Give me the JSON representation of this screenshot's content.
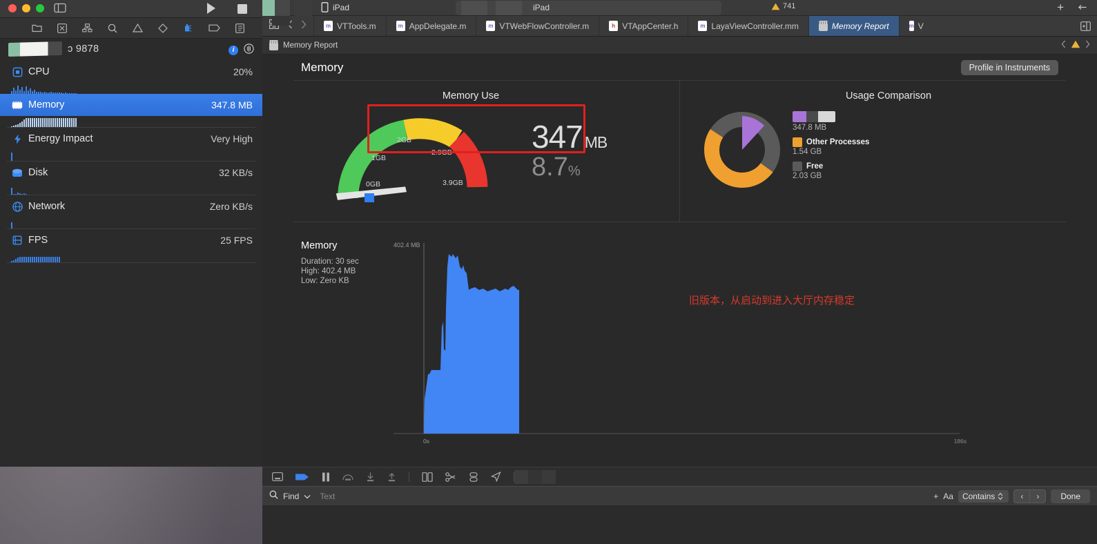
{
  "window": {
    "scheme_device": "iPad",
    "scheme_destination": "iPad",
    "warning_count": "741",
    "redacted_pid": "ɔ 9878"
  },
  "tabs": [
    {
      "label": "VTTools.m",
      "type": "m",
      "active": false
    },
    {
      "label": "AppDelegate.m",
      "type": "m",
      "active": false
    },
    {
      "label": "VTWebFlowController.m",
      "type": "m",
      "active": false
    },
    {
      "label": "VTAppCenter.h",
      "type": "h",
      "active": false
    },
    {
      "label": "LayaViewController.mm",
      "type": "m",
      "active": false
    },
    {
      "label": "Memory Report",
      "type": "mem",
      "active": true
    },
    {
      "label": "V",
      "type": "m",
      "active": false
    }
  ],
  "jumpbar": {
    "label": "Memory Report"
  },
  "gauges": {
    "items": [
      {
        "name": "CPU",
        "value": "20%",
        "selected": false
      },
      {
        "name": "Memory",
        "value": "347.8 MB",
        "selected": true
      },
      {
        "name": "Energy Impact",
        "value": "Very High",
        "selected": false
      },
      {
        "name": "Disk",
        "value": "32 KB/s",
        "selected": false
      },
      {
        "name": "Network",
        "value": "Zero KB/s",
        "selected": false
      },
      {
        "name": "FPS",
        "value": "25 FPS",
        "selected": false
      }
    ]
  },
  "report": {
    "title": "Memory",
    "profile_button": "Profile in Instruments"
  },
  "chart_data": [
    {
      "type": "gauge",
      "title": "Memory Use",
      "value": 347,
      "unit": "MB",
      "percent": "8.7",
      "percent_unit": "%",
      "value_display": "347",
      "tick_labels": [
        "0GB",
        "1GB",
        "2GB",
        "2.9GB",
        "3.9GB"
      ],
      "zones": [
        {
          "color": "#4ec95a",
          "from": "0GB",
          "to": "2GB"
        },
        {
          "color": "#f5cc2a",
          "from": "2GB",
          "to": "2.9GB"
        },
        {
          "color": "#e8352e",
          "from": "2.9GB",
          "to": "3.9GB"
        }
      ],
      "needle_value_marker_color": "#2f7ff0",
      "highlight_box_color": "#e02020"
    },
    {
      "type": "pie",
      "title": "Usage Comparison",
      "categories": [
        "App (redacted)",
        "Other Processes",
        "Free"
      ],
      "values": [
        0.3478,
        1.54,
        2.03
      ],
      "value_labels": [
        "347.8 MB",
        "1.54 GB",
        "2.03 GB"
      ],
      "colors": [
        "#a974d8",
        "#f0a030",
        "#5a5a5a"
      ],
      "legend": "right",
      "app_label_redacted": true
    },
    {
      "type": "area",
      "title": "Memory",
      "duration": "Duration: 30 sec",
      "high": "High: 402.4 MB",
      "low": "Low: Zero KB",
      "ylabel": "402.4 MB",
      "ylim": [
        0,
        402.4
      ],
      "xlabel_start": "0s",
      "xlabel_end": "186s",
      "series_color": "#4285f4",
      "annotation": "旧版本，从启动到进入大厅内存稳定",
      "annotation_color": "#d83a2a",
      "x": [
        0,
        2,
        4,
        6,
        8,
        10,
        12,
        14,
        16,
        18,
        20,
        22,
        24,
        26,
        28,
        30,
        32,
        34,
        36,
        38,
        40,
        42,
        44,
        46,
        48,
        50,
        52,
        54,
        56,
        58,
        60,
        62,
        64,
        66,
        68,
        70,
        72,
        74,
        76,
        78,
        80,
        82,
        84,
        86,
        88,
        90,
        92
      ],
      "values": [
        0,
        18,
        148,
        152,
        152,
        152,
        152,
        152,
        152,
        152,
        152,
        152,
        152,
        152,
        152,
        152,
        152,
        250,
        205,
        205,
        360,
        398,
        402,
        390,
        386,
        394,
        372,
        330,
        334,
        336,
        336,
        332,
        330,
        334,
        332,
        330,
        334,
        336,
        334,
        332,
        336,
        334,
        336,
        338,
        336,
        330,
        0
      ]
    }
  ],
  "findbar": {
    "label": "Find",
    "placeholder": "Text",
    "match_mode": "Contains",
    "case_label": "Aa",
    "done_label": "Done"
  }
}
